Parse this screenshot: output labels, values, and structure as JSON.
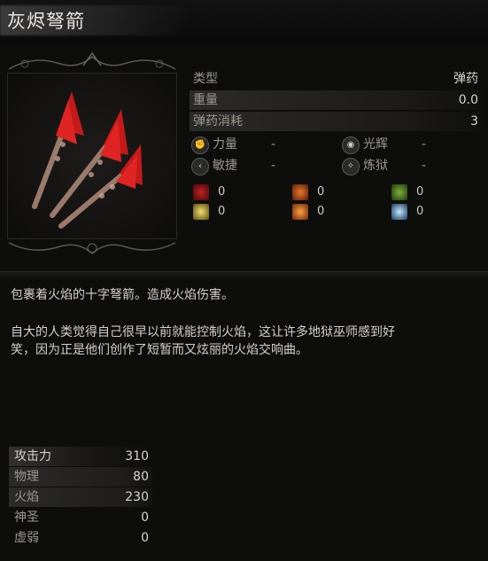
{
  "item": {
    "name": "灰烬弩箭"
  },
  "stats": [
    {
      "label": "类型",
      "value": "弹药"
    },
    {
      "label": "重量",
      "value": "0.0"
    },
    {
      "label": "弹药消耗",
      "value": "3"
    }
  ],
  "scaling": [
    {
      "icon": "strength-icon",
      "label": "力量",
      "grade": "-"
    },
    {
      "icon": "radiance-icon",
      "label": "光辉",
      "grade": "-"
    },
    {
      "icon": "agility-icon",
      "label": "敏捷",
      "grade": "-"
    },
    {
      "icon": "inferno-icon",
      "label": "炼狱",
      "grade": "-"
    }
  ],
  "defenses": [
    {
      "icon": "bleed-icon",
      "value": "0",
      "color": "#8a1a1a"
    },
    {
      "icon": "fire-icon",
      "value": "0",
      "color": "#c8561a"
    },
    {
      "icon": "poison-icon",
      "value": "0",
      "color": "#5a8a2a"
    },
    {
      "icon": "holy-icon",
      "value": "0",
      "color": "#d8c04a"
    },
    {
      "icon": "burn-icon",
      "value": "0",
      "color": "#e06a1a"
    },
    {
      "icon": "frost-icon",
      "value": "0",
      "color": "#6ab0d8"
    }
  ],
  "description": {
    "line1": "包裹着火焰的十字弩箭。造成火焰伤害。",
    "para2_line1": "自大的人类觉得自己很早以前就能控制火焰，这让许多地狱巫师感到好",
    "para2_line2": "笑，因为正是他们创作了短暂而又炫丽的火焰交响曲。"
  },
  "attack": [
    {
      "label": "攻击力",
      "value": "310"
    },
    {
      "label": "物理",
      "value": "80"
    },
    {
      "label": "火焰",
      "value": "230"
    },
    {
      "label": "神圣",
      "value": "0"
    },
    {
      "label": "虚弱",
      "value": "0"
    }
  ]
}
